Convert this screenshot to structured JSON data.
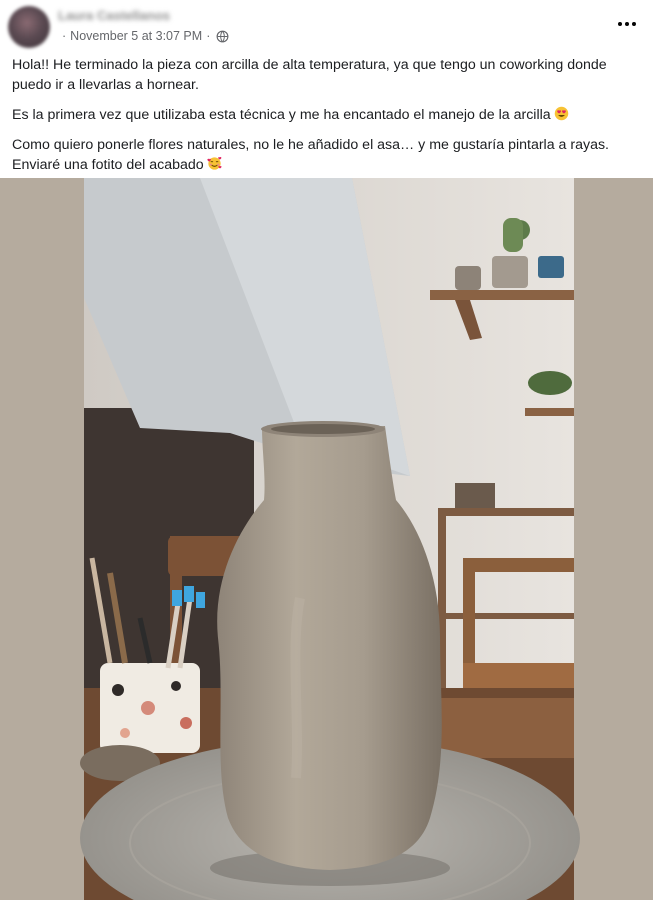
{
  "post": {
    "author_name": "Laura Castellanos",
    "timestamp": "November 5 at 3:07 PM",
    "separator": "·",
    "privacy_icon": "globe-icon",
    "more_icon": "more-horizontal-icon",
    "paragraphs": [
      "Hola!! He terminado la pieza con arcilla de alta temperatura, ya que tengo un coworking donde puedo ir a llevarlas a hornear.",
      "Es la primera vez que utilizaba esta técnica y me ha encantado el manejo de la arcilla",
      "Como quiero ponerle flores naturales, no le he añadido el asa… y me gustaría pintarla a rayas. Enviaré una fotito del acabado"
    ],
    "emoji_names": [
      "heart-eyes-emoji",
      "smiling-face-with-hearts-emoji"
    ],
    "photo_name": "clay-vase-photo"
  }
}
